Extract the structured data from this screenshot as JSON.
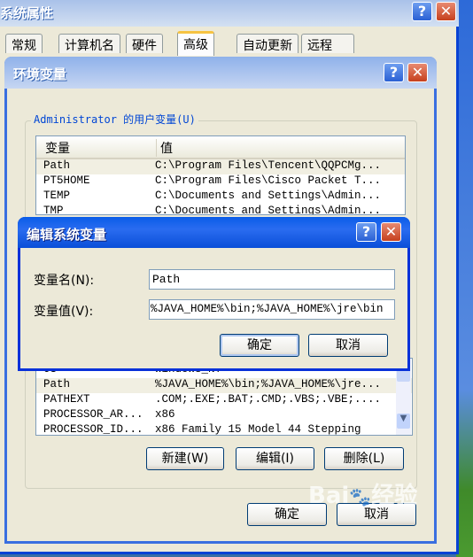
{
  "system_properties": {
    "title": "系统属性",
    "tabs": [
      "常规",
      "计算机名",
      "硬件",
      "高级",
      "自动更新",
      "远程"
    ],
    "active_tab": "高级"
  },
  "env_dialog": {
    "title": "环境变量",
    "user_group_label": "Administrator 的用户变量(U)",
    "columns": [
      "变量",
      "值"
    ],
    "user_vars": [
      {
        "name": "Path",
        "value": "C:\\Program Files\\Tencent\\QQPCMg..."
      },
      {
        "name": "PT5HOME",
        "value": "C:\\Program Files\\Cisco Packet T..."
      },
      {
        "name": "TEMP",
        "value": "C:\\Documents and Settings\\Admin..."
      },
      {
        "name": "TMP",
        "value": "C:\\Documents and Settings\\Admin..."
      }
    ],
    "system_vars": [
      {
        "name": "OS",
        "value": "Windows_NT"
      },
      {
        "name": "Path",
        "value": "%JAVA_HOME%\\bin;%JAVA_HOME%\\jre..."
      },
      {
        "name": "PATHEXT",
        "value": ".COM;.EXE;.BAT;.CMD;.VBS;.VBE;...."
      },
      {
        "name": "PROCESSOR_AR...",
        "value": "x86"
      },
      {
        "name": "PROCESSOR_ID...",
        "value": "x86 Family 15 Model 44 Stepping"
      }
    ],
    "new_label": "新建(W)",
    "edit_label": "编辑(I)",
    "delete_label": "删除(L)",
    "ok_label": "确定",
    "cancel_label": "取消"
  },
  "edit_dialog": {
    "title": "编辑系统变量",
    "name_label": "变量名(N):",
    "name_value": "Path",
    "value_label": "变量值(V):",
    "value_value": "%JAVA_HOME%\\bin;%JAVA_HOME%\\jre\\bin",
    "ok_label": "确定",
    "cancel_label": "取消"
  },
  "watermark": "Baidu经验 jingyan.baidu.com",
  "icons": {
    "help": "help-icon",
    "close": "close-icon"
  },
  "colors": {
    "titlebar_active": "#0a5ce8",
    "titlebar_inactive": "#a9c1e9",
    "close": "#c6401e"
  }
}
